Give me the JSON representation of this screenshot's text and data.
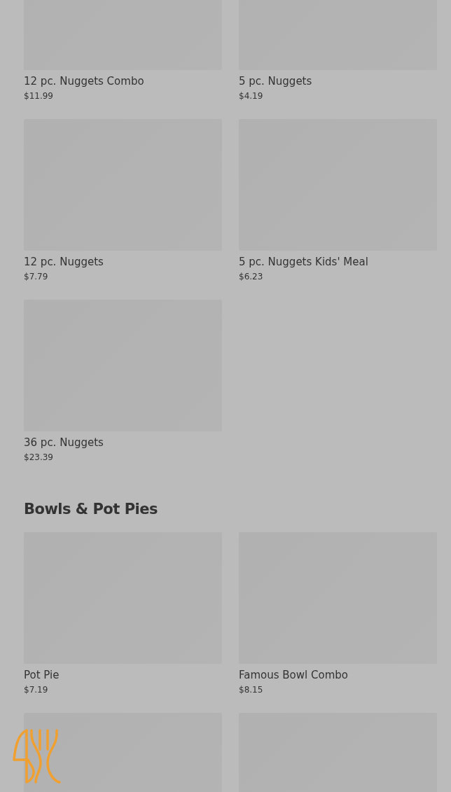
{
  "sections": [
    {
      "items": [
        {
          "kind": "product",
          "name": "12 pc. Nuggets Combo",
          "price": "$11.99"
        },
        {
          "kind": "product",
          "name": "5 pc. Nuggets",
          "price": "$4.19"
        },
        {
          "kind": "product",
          "name": "12 pc. Nuggets",
          "price": "$7.79"
        },
        {
          "kind": "product",
          "name": "5 pc. Nuggets Kids' Meal",
          "price": "$6.23"
        },
        {
          "kind": "product",
          "name": "36 pc. Nuggets",
          "price": "$23.39"
        }
      ]
    },
    {
      "title": "Bowls & Pot Pies",
      "items": [
        {
          "kind": "product",
          "name": "Pot Pie",
          "price": "$7.19"
        },
        {
          "kind": "product",
          "name": "Famous Bowl Combo",
          "price": "$8.15"
        },
        {
          "kind": "image_only"
        },
        {
          "kind": "image_only"
        }
      ]
    }
  ]
}
